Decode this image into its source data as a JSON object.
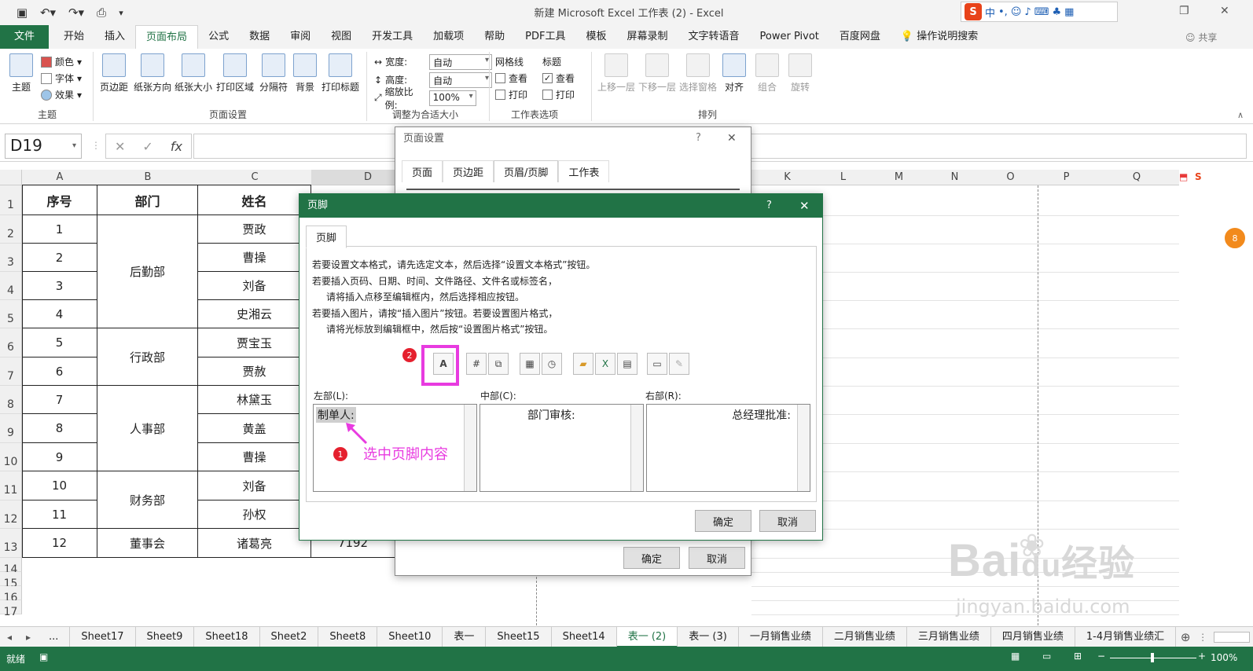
{
  "window": {
    "title": "新建 Microsoft Excel 工作表 (2) - Excel",
    "share": "共享"
  },
  "ime": {
    "logo": "S",
    "mode": "中",
    "punct": "•,"
  },
  "ribbon_tabs": [
    "文件",
    "开始",
    "插入",
    "页面布局",
    "公式",
    "数据",
    "审阅",
    "视图",
    "开发工具",
    "加载项",
    "帮助",
    "PDF工具",
    "模板",
    "屏幕录制",
    "文字转语音",
    "Power Pivot",
    "百度网盘"
  ],
  "tell_me": "操作说明搜索",
  "ribbon": {
    "theme": {
      "main": "主题",
      "colors": "颜色",
      "fonts": "字体",
      "effects": "效果",
      "group": "主题"
    },
    "page_setup": {
      "items": [
        "页边距",
        "纸张方向",
        "纸张大小",
        "打印区域",
        "分隔符",
        "背景",
        "打印标题"
      ],
      "group": "页面设置"
    },
    "scale": {
      "width_label": "宽度:",
      "width_val": "自动",
      "height_label": "高度:",
      "height_val": "自动",
      "scale_label": "缩放比例:",
      "scale_val": "100%",
      "group": "调整为合适大小"
    },
    "sheet_opts": {
      "gridlines": "网格线",
      "headings": "标题",
      "view": "查看",
      "print": "打印",
      "group": "工作表选项"
    },
    "arrange": {
      "items": [
        "上移一层",
        "下移一层",
        "选择窗格",
        "对齐",
        "组合",
        "旋转"
      ],
      "group": "排列"
    }
  },
  "formula_bar": {
    "namebox": "D19",
    "fx": "fx",
    "cancel": "✕",
    "enter": "✓"
  },
  "columns": [
    "A",
    "B",
    "C",
    "D",
    "K",
    "L",
    "M",
    "N",
    "O",
    "P",
    "Q"
  ],
  "rows": [
    "1",
    "2",
    "3",
    "4",
    "5",
    "6",
    "7",
    "8",
    "9",
    "10",
    "11",
    "12",
    "13",
    "14",
    "15",
    "16",
    "17"
  ],
  "table": {
    "headers": [
      "序号",
      "部门",
      "姓名",
      "D"
    ],
    "numbers": [
      "1",
      "2",
      "3",
      "4",
      "5",
      "6",
      "7",
      "8",
      "9",
      "10",
      "11",
      "12"
    ],
    "depts": [
      "后勤部",
      "行政部",
      "人事部",
      "财务部",
      "董事会"
    ],
    "names": [
      "贾政",
      "曹操",
      "刘备",
      "史湘云",
      "贾宝玉",
      "贾赦",
      "林黛玉",
      "黄盖",
      "曹操",
      "刘备",
      "孙权",
      "诸葛亮"
    ],
    "d13": "7192"
  },
  "page_setup_dialog": {
    "title": "页面设置",
    "help": "?",
    "tabs": [
      "页面",
      "页边距",
      "页眉/页脚",
      "工作表"
    ],
    "ok": "确定",
    "cancel": "取消"
  },
  "footer_dialog": {
    "title": "页脚",
    "help": "?",
    "tab": "页脚",
    "instructions": [
      "若要设置文本格式，请先选定文本，然后选择“设置文本格式”按钮。",
      "若要插入页码、日期、时间、文件路径、文件名或标签名，",
      "请将插入点移至编辑框内，然后选择相应按钮。",
      "若要插入图片，请按“插入图片”按钮。若要设置图片格式，",
      "请将光标放到编辑框中，然后按“设置图片格式”按钮。"
    ],
    "format_text_glyph": "A",
    "left_label": "左部(L):",
    "center_label": "中部(C):",
    "right_label": "右部(R):",
    "left_text": "制单人:",
    "center_text": "部门审核:",
    "right_text": "总经理批准:",
    "ok": "确定",
    "cancel": "取消"
  },
  "annotations": {
    "step1": "1",
    "step2": "2",
    "hint": "选中页脚内容",
    "accent": "#e83be0"
  },
  "sheet_tabs": [
    "...",
    "Sheet17",
    "Sheet9",
    "Sheet18",
    "Sheet2",
    "Sheet8",
    "Sheet10",
    "表一",
    "Sheet15",
    "Sheet14",
    "表一 (2)",
    "表一 (3)",
    "一月销售业绩",
    "二月销售业绩",
    "三月销售业绩",
    "四月销售业绩",
    "1-4月销售业绩汇"
  ],
  "active_sheet": "表一 (2)",
  "status": {
    "mode": "就绪",
    "zoom": "100%"
  },
  "watermark": {
    "brand": "Bai",
    "du": "du",
    "cn": "经验",
    "url": "jingyan.baidu.com"
  },
  "colors": {
    "excel_green": "#217346",
    "accent": "#e83be0",
    "badge_red": "#e5202e"
  }
}
